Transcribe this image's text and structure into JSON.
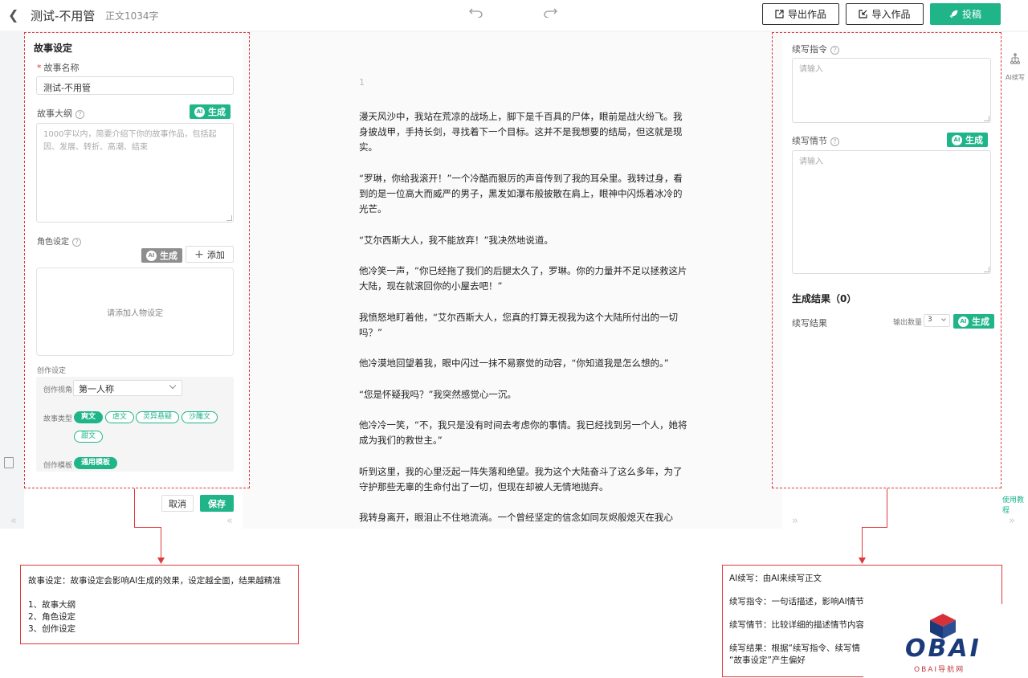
{
  "header": {
    "back_icon": "chevron-left-icon",
    "title": "测试-不用管",
    "word_count": "正文1034字",
    "undo_icon": "undo-icon",
    "redo_icon": "redo-icon",
    "export_label": "导出作品",
    "import_label": "导入作品",
    "submit_label": "投稿",
    "accent_color": "#1fb589"
  },
  "story_settings": {
    "title": "故事设定",
    "name_label": "故事名称",
    "name_value": "测试-不用管",
    "outline_label": "故事大纲",
    "outline_placeholder": "1000字以内，简要介绍下你的故事作品，包括起因、发展、转折、高潮、结束",
    "generate_label": "生成",
    "ai_badge": "AI",
    "character_label": "角色设定",
    "add_label": "添加",
    "character_empty": "请添加人物设定",
    "creation_label": "创作设定",
    "perspective_label": "创作视角",
    "perspective_value": "第一人称",
    "genre_label": "故事类型",
    "genres": [
      "爽文",
      "虐文",
      "灵异悬疑",
      "沙雕文",
      "甜文"
    ],
    "selected_genre": "爽文",
    "template_label": "创作模板",
    "template_value": "通用模板",
    "cancel_label": "取消",
    "save_label": "保存"
  },
  "editor": {
    "page_number": "1",
    "paragraphs": [
      "漫天风沙中，我站在荒凉的战场上，脚下是千百具的尸体，眼前是战火纷飞。我身披战甲，手持长剑，寻找着下一个目标。这并不是我想要的结局，但这就是现实。",
      "“罗琳，你给我滚开！”一个冷酷而狠厉的声音传到了我的耳朵里。我转过身，看到的是一位高大而威严的男子，黑发如瀑布般披散在肩上，眼神中闪烁着冰冷的光芒。",
      "“艾尔西斯大人，我不能放弃！”我决然地说道。",
      "他冷笑一声，“你已经拖了我们的后腿太久了，罗琳。你的力量并不足以拯救这片大陆，现在就滚回你的小屋去吧！”",
      "我愤怒地盯着他，“艾尔西斯大人，您真的打算无视我为这个大陆所付出的一切吗？”",
      "他冷漠地回望着我，眼中闪过一抹不易察觉的动容，“你知道我是怎么想的。”",
      "“您是怀疑我吗？”我突然感觉心一沉。",
      "他冷冷一笑，“不，我只是没有时间去考虑你的事情。我已经找到另一个人，她将成为我们的救世主。”",
      "听到这里，我的心里泛起一阵失落和绝望。我为这个大陆奋斗了这么多年，为了守护那些无辜的生命付出了一切，但现在却被人无情地抛弃。",
      "我转身离开，眼泪止不住地流淌。一个曾经坚定的信念如同灰烬般熄灭在我心"
    ]
  },
  "ai_continue": {
    "instruction_label": "续写指令",
    "instruction_placeholder": "请输入",
    "plot_label": "续写情节",
    "plot_placeholder": "请输入",
    "generate_label": "生成",
    "results_header": "生成结果（0）",
    "results_label": "续写结果",
    "output_count_label": "输出数量",
    "output_count_value": "3"
  },
  "rail": {
    "ai_label": "AI续写",
    "tutorial_label": "使用教程"
  },
  "annotations": {
    "left_title": "故事设定：故事设定会影响AI生成的效果，设定越全面，结果越精准",
    "left_items": [
      "1、故事大纲",
      "2、角色设定",
      "3、创作设定"
    ],
    "right_lines": [
      "AI续写：由AI来续写正文",
      "续写指令：一句话描述，影响AI情节",
      "续写情节：比较详细的描述情节内容",
      "续写结果：根据“续写指令、续写情",
      "“故事设定”产生偏好"
    ]
  },
  "watermark": {
    "logo_text": "OBAI",
    "logo_sub": "OBAI导航网"
  }
}
